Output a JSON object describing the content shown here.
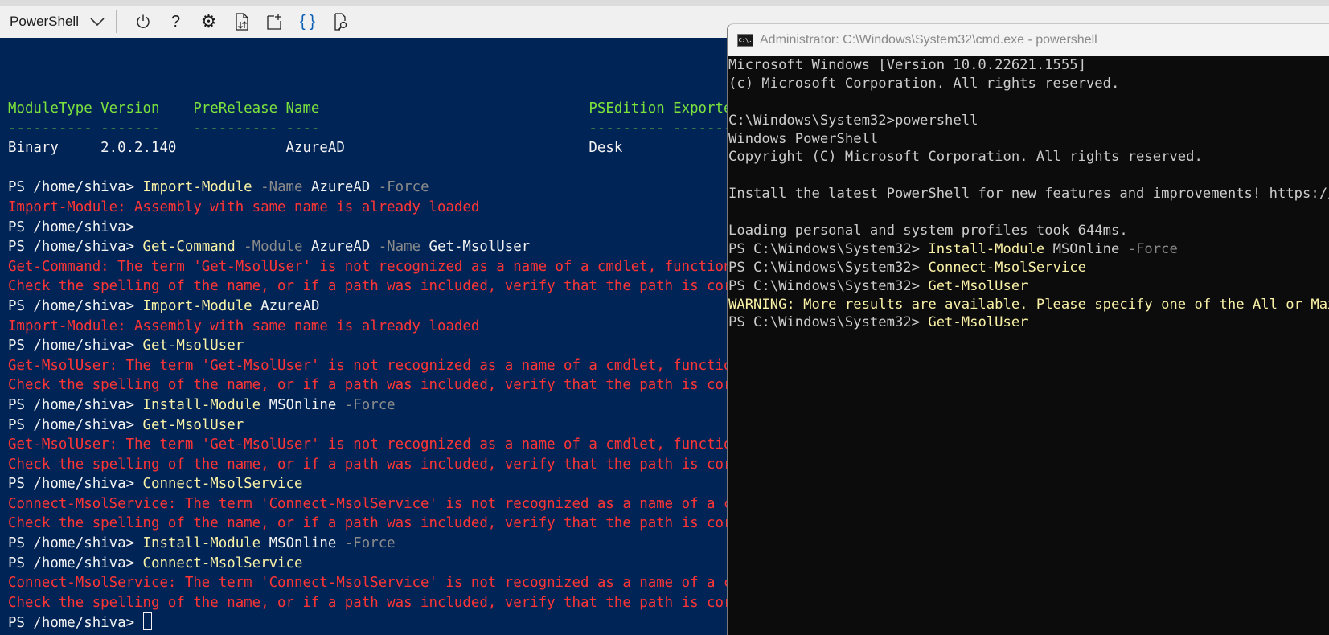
{
  "toolbar": {
    "shell_selector": "PowerShell",
    "buttons": [
      {
        "name": "power-icon",
        "label": "Restart"
      },
      {
        "name": "help-icon",
        "label": "Help"
      },
      {
        "name": "gear-icon",
        "label": "Settings"
      },
      {
        "name": "upload-download-icon",
        "label": "Upload/Download files"
      },
      {
        "name": "new-session-icon",
        "label": "Open new session"
      },
      {
        "name": "braces-icon",
        "label": "Editor"
      },
      {
        "name": "web-preview-icon",
        "label": "Web preview"
      }
    ]
  },
  "colors": {
    "terminal_bg": "#012456",
    "cmd_bg": "#0c0c0c",
    "header": "#7be23c",
    "command": "#f9f1a5",
    "param": "#8a8a8a",
    "error": "#ff3535"
  },
  "terminal": {
    "lines": [
      [
        [
          "ModuleType Version    PreRelease Name                                PSEdition ExportedCommands",
          "g"
        ]
      ],
      [
        [
          "---------- -------    ---------- ----                                --------- ----------------",
          "g"
        ]
      ],
      [
        [
          "Binary     2.0.2.140             AzureAD                             Desk",
          "w"
        ]
      ],
      [],
      [
        [
          "PS /home/shiva> ",
          "w"
        ],
        [
          "Import-Module",
          "y"
        ],
        [
          " -Name",
          "p"
        ],
        [
          " AzureAD",
          "w"
        ],
        [
          " -Force",
          "p"
        ]
      ],
      [
        [
          "Import-Module: Assembly with same name is already loaded",
          "r"
        ]
      ],
      [
        [
          "PS /home/shiva> ",
          "w"
        ]
      ],
      [
        [
          "PS /home/shiva> ",
          "w"
        ],
        [
          "Get-Command",
          "y"
        ],
        [
          " -Module",
          "p"
        ],
        [
          " AzureAD",
          "w"
        ],
        [
          " -Name",
          "p"
        ],
        [
          " Get-MsolUser",
          "w"
        ]
      ],
      [
        [
          "Get-Command: The term 'Get-MsolUser' is not recognized as a name of a cmdlet, function",
          "r"
        ]
      ],
      [
        [
          "Check the spelling of the name, or if a path was included, verify that the path is cor",
          "r"
        ]
      ],
      [
        [
          "PS /home/shiva> ",
          "w"
        ],
        [
          "Import-Module",
          "y"
        ],
        [
          " AzureAD",
          "w"
        ]
      ],
      [
        [
          "Import-Module: Assembly with same name is already loaded",
          "r"
        ]
      ],
      [
        [
          "PS /home/shiva> ",
          "w"
        ],
        [
          "Get-MsolUser",
          "y"
        ]
      ],
      [
        [
          "Get-MsolUser: The term 'Get-MsolUser' is not recognized as a name of a cmdlet, functio",
          "r"
        ]
      ],
      [
        [
          "Check the spelling of the name, or if a path was included, verify that the path is cor",
          "r"
        ]
      ],
      [
        [
          "PS /home/shiva> ",
          "w"
        ],
        [
          "Install-Module",
          "y"
        ],
        [
          " MSOnline",
          "w"
        ],
        [
          " -Force",
          "p"
        ]
      ],
      [
        [
          "PS /home/shiva> ",
          "w"
        ],
        [
          "Get-MsolUser",
          "y"
        ]
      ],
      [
        [
          "Get-MsolUser: The term 'Get-MsolUser' is not recognized as a name of a cmdlet, functio",
          "r"
        ]
      ],
      [
        [
          "Check the spelling of the name, or if a path was included, verify that the path is cor",
          "r"
        ]
      ],
      [
        [
          "PS /home/shiva> ",
          "w"
        ],
        [
          "Connect-MsolService",
          "y"
        ]
      ],
      [
        [
          "Connect-MsolService: The term 'Connect-MsolService' is not recognized as a name of a c",
          "r"
        ]
      ],
      [
        [
          "Check the spelling of the name, or if a path was included, verify that the path is cor",
          "r"
        ]
      ],
      [
        [
          "PS /home/shiva> ",
          "w"
        ],
        [
          "Install-Module",
          "y"
        ],
        [
          " MSOnline",
          "w"
        ],
        [
          " -Force",
          "p"
        ]
      ],
      [
        [
          "PS /home/shiva> ",
          "w"
        ],
        [
          "Connect-MsolService",
          "y"
        ]
      ],
      [
        [
          "Connect-MsolService: The term 'Connect-MsolService' is not recognized as a name of a c",
          "r"
        ]
      ],
      [
        [
          "Check the spelling of the name, or if a path was included, verify that the path is cor",
          "r"
        ]
      ],
      [
        [
          "PS /home/shiva> ",
          "w"
        ]
      ]
    ]
  },
  "cmd_window": {
    "title": "Administrator: C:\\Windows\\System32\\cmd.exe - powershell",
    "icon_text": "C:\\.",
    "lines": [
      [
        [
          "Microsoft Windows [Version 10.0.22621.1555]",
          "c"
        ]
      ],
      [
        [
          "(c) Microsoft Corporation. All rights reserved.",
          "c"
        ]
      ],
      [],
      [
        [
          "C:\\Windows\\System32>powershell",
          "c"
        ]
      ],
      [
        [
          "Windows PowerShell",
          "c"
        ]
      ],
      [
        [
          "Copyright (C) Microsoft Corporation. All rights reserved.",
          "c"
        ]
      ],
      [],
      [
        [
          "Install the latest PowerShell for new features and improvements! https://aka.ms/PSWindows",
          "c"
        ]
      ],
      [],
      [
        [
          "Loading personal and system profiles took 644ms.",
          "c"
        ]
      ],
      [
        [
          "PS C:\\Windows\\System32> ",
          "c"
        ],
        [
          "Install-Module",
          "y"
        ],
        [
          " MSOnline",
          "c"
        ],
        [
          " -Force",
          "p"
        ]
      ],
      [
        [
          "PS C:\\Windows\\System32> ",
          "c"
        ],
        [
          "Connect-MsolService",
          "y"
        ]
      ],
      [
        [
          "PS C:\\Windows\\System32> ",
          "c"
        ],
        [
          "Get-MsolUser",
          "y"
        ]
      ],
      [
        [
          "WARNING: More results are available. Please specify one of the All or MaxResults parameters.",
          "y"
        ]
      ],
      [
        [
          "PS C:\\Windows\\System32> ",
          "c"
        ],
        [
          "Get-MsolUser",
          "y"
        ]
      ]
    ]
  }
}
